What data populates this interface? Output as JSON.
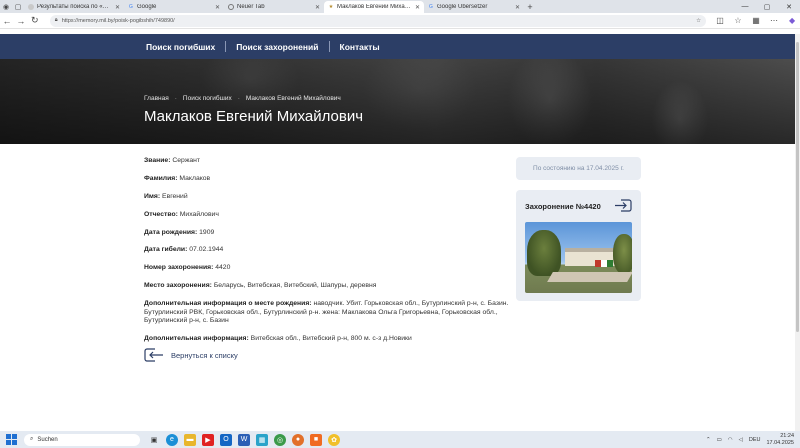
{
  "browser": {
    "tabs": [
      {
        "label": "Результаты поиска по «Семейн",
        "icon": "document-icon",
        "active": false
      },
      {
        "label": "Google",
        "icon": "google-icon",
        "active": false
      },
      {
        "label": "Neuer Tab",
        "icon": "newtab-icon",
        "active": false
      },
      {
        "label": "Маклаков Евгений Михайлови",
        "icon": "star-icon",
        "active": true
      },
      {
        "label": "Google Übersetzer",
        "icon": "translate-icon",
        "active": false
      }
    ],
    "url": "https://memory.mil.by/poisk-pogibshih/749890/"
  },
  "site_nav": {
    "items": [
      "Поиск погибших",
      "Поиск захоронений",
      "Контакты"
    ]
  },
  "breadcrumb": [
    "Главная",
    "Поиск погибших",
    "Маклаков Евгений Михайлович"
  ],
  "page_title": "Маклаков Евгений Михайлович",
  "fields": [
    {
      "label": "Звание:",
      "value": "Сержант"
    },
    {
      "label": "Фамилия:",
      "value": "Маклаков"
    },
    {
      "label": "Имя:",
      "value": "Евгений"
    },
    {
      "label": "Отчество:",
      "value": "Михайлович"
    },
    {
      "label": "Дата рождения:",
      "value": "1909"
    },
    {
      "label": "Дата гибели:",
      "value": "07.02.1944"
    },
    {
      "label": "Номер захоронения:",
      "value": "4420"
    },
    {
      "label": "Место захоронения:",
      "value": "Беларусь, Витебская, Витебский, Шапуры, деревня"
    },
    {
      "label": "Дополнительная информация о месте рождения:",
      "value": "наводчик. Убит. Горьковская обл., Бутурлинский р-н, с. Базин. Бутурлинский РВК, Горьковская обл., Бутурлинский р-н. жена: Маклакова Ольга Григорьевна, Горьковская обл., Бутурлинский р-н, с. Базин"
    },
    {
      "label": "Дополнительная информация:",
      "value": "Витебская обл., Витебский р-н, 800 м. с-з д.Новики"
    }
  ],
  "status_text": "По состоянию на 17.04.2025 г.",
  "burial_card": {
    "title": "Захоронение №4420"
  },
  "back_link": "Вернуться к списку",
  "taskbar": {
    "search_placeholder": "Suchen",
    "language": "DEU",
    "time": "21:24",
    "date": "17.04.2025"
  },
  "colors": {
    "nav_bg": "#2c3e66",
    "card_bg": "#e9edf3",
    "accent": "#2c3e66"
  }
}
